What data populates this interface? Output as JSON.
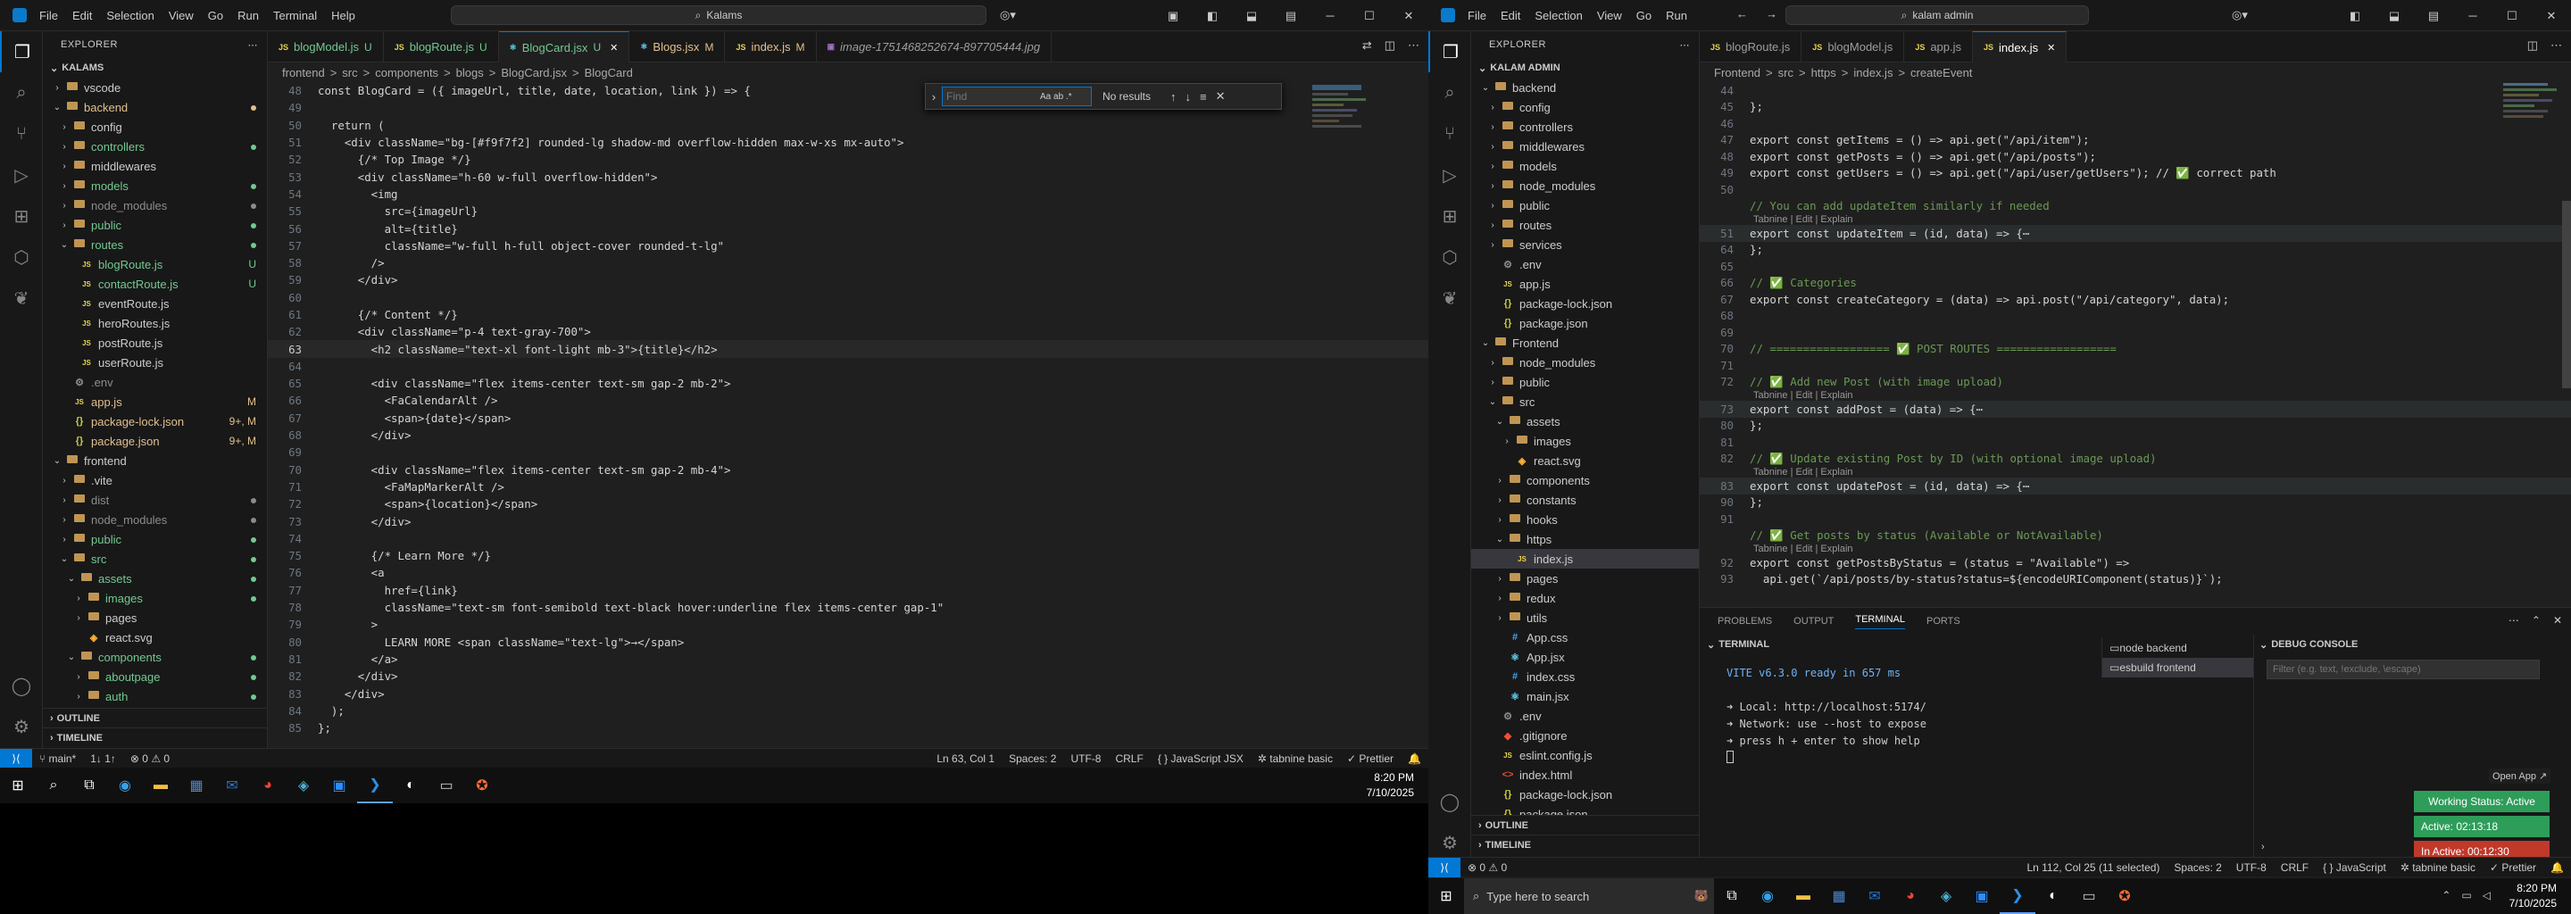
{
  "left": {
    "menu": [
      "File",
      "Edit",
      "Selection",
      "View",
      "Go",
      "Run",
      "Terminal",
      "Help"
    ],
    "search": "Kalams",
    "explorer_title": "EXPLORER",
    "root": "KALAMS",
    "tree": [
      {
        "d": 1,
        "t": "folder",
        "c": "closed",
        "name": "vscode"
      },
      {
        "d": 1,
        "t": "folder",
        "c": "open",
        "name": "backend",
        "color": "#e2c08d"
      },
      {
        "d": 2,
        "t": "folder",
        "c": "closed",
        "name": "config"
      },
      {
        "d": 2,
        "t": "folder",
        "c": "closed",
        "name": "controllers",
        "color": "#73c991"
      },
      {
        "d": 2,
        "t": "folder",
        "c": "closed",
        "name": "middlewares"
      },
      {
        "d": 2,
        "t": "folder",
        "c": "closed",
        "name": "models",
        "color": "#73c991"
      },
      {
        "d": 2,
        "t": "folder",
        "c": "closed",
        "name": "node_modules",
        "color": "#8c8c8c"
      },
      {
        "d": 2,
        "t": "folder",
        "c": "closed",
        "name": "public",
        "color": "#73c991"
      },
      {
        "d": 2,
        "t": "folder",
        "c": "open",
        "name": "routes",
        "color": "#73c991"
      },
      {
        "d": 3,
        "t": "js",
        "name": "blogRoute.js",
        "color": "#73c991",
        "badge": "U"
      },
      {
        "d": 3,
        "t": "js",
        "name": "contactRoute.js",
        "color": "#73c991",
        "badge": "U"
      },
      {
        "d": 3,
        "t": "js",
        "name": "eventRoute.js"
      },
      {
        "d": 3,
        "t": "js",
        "name": "heroRoutes.js"
      },
      {
        "d": 3,
        "t": "js",
        "name": "postRoute.js"
      },
      {
        "d": 3,
        "t": "js",
        "name": "userRoute.js"
      },
      {
        "d": 2,
        "t": "env",
        "name": ".env",
        "color": "#8c8c8c"
      },
      {
        "d": 2,
        "t": "js",
        "name": "app.js",
        "color": "#e2c08d",
        "badge": "M"
      },
      {
        "d": 2,
        "t": "json",
        "name": "package-lock.json",
        "color": "#e2c08d",
        "badge": "9+, M"
      },
      {
        "d": 2,
        "t": "json",
        "name": "package.json",
        "color": "#e2c08d",
        "badge": "9+, M"
      },
      {
        "d": 1,
        "t": "folder",
        "c": "open",
        "name": "frontend"
      },
      {
        "d": 2,
        "t": "folder",
        "c": "closed",
        "name": ".vite"
      },
      {
        "d": 2,
        "t": "folder",
        "c": "closed",
        "name": "dist",
        "color": "#8c8c8c"
      },
      {
        "d": 2,
        "t": "folder",
        "c": "closed",
        "name": "node_modules",
        "color": "#8c8c8c"
      },
      {
        "d": 2,
        "t": "folder",
        "c": "closed",
        "name": "public",
        "color": "#73c991"
      },
      {
        "d": 2,
        "t": "folder",
        "c": "open",
        "name": "src",
        "color": "#73c991"
      },
      {
        "d": 3,
        "t": "folder",
        "c": "open",
        "name": "assets",
        "color": "#73c991"
      },
      {
        "d": 4,
        "t": "folder",
        "c": "closed",
        "name": "images",
        "color": "#73c991"
      },
      {
        "d": 4,
        "t": "folder",
        "c": "closed",
        "name": "pages"
      },
      {
        "d": 4,
        "t": "svg",
        "name": "react.svg"
      },
      {
        "d": 3,
        "t": "folder",
        "c": "open",
        "name": "components",
        "color": "#73c991"
      },
      {
        "d": 4,
        "t": "folder",
        "c": "closed",
        "name": "aboutpage",
        "color": "#73c991"
      },
      {
        "d": 4,
        "t": "folder",
        "c": "closed",
        "name": "auth",
        "color": "#73c991"
      }
    ],
    "outline": "OUTLINE",
    "timeline": "TIMELINE",
    "tabs": [
      {
        "name": "blogModel.js",
        "mod": "U"
      },
      {
        "name": "blogRoute.js",
        "mod": "U"
      },
      {
        "name": "BlogCard.jsx",
        "mod": "U",
        "active": true
      },
      {
        "name": "Blogs.jsx",
        "mod": "M"
      },
      {
        "name": "index.js",
        "mod": "M"
      },
      {
        "name": "image-1751468252674-897705444.jpg",
        "mod": ""
      }
    ],
    "breadcrumb": [
      "frontend",
      ">",
      "src",
      ">",
      "components",
      ">",
      "blogs",
      ">",
      "BlogCard.jsx",
      ">",
      "BlogCard"
    ],
    "find": {
      "placeholder": "Find",
      "result": "No results",
      "opts": "Aa  ab  .*"
    },
    "code_start": 48,
    "code": [
      "const BlogCard = ({ imageUrl, title, date, location, link }) => {",
      "",
      "  return (",
      "    <div className=\"bg-[#f9f7f2] rounded-lg shadow-md overflow-hidden max-w-xs mx-auto\">",
      "      {/* Top Image */}",
      "      <div className=\"h-60 w-full overflow-hidden\">",
      "        <img",
      "          src={imageUrl}",
      "          alt={title}",
      "          className=\"w-full h-full object-cover rounded-t-lg\"",
      "        />",
      "      </div>",
      "",
      "      {/* Content */}",
      "      <div className=\"p-4 text-gray-700\">",
      "        <h2 className=\"text-xl font-light mb-3\">{title}</h2>",
      "",
      "        <div className=\"flex items-center text-sm gap-2 mb-2\">",
      "          <FaCalendarAlt />",
      "          <span>{date}</span>",
      "        </div>",
      "",
      "        <div className=\"flex items-center text-sm gap-2 mb-4\">",
      "          <FaMapMarkerAlt />",
      "          <span>{location}</span>",
      "        </div>",
      "",
      "        {/* Learn More */}",
      "        <a",
      "          href={link}",
      "          className=\"text-sm font-semibold text-black hover:underline flex items-center gap-1\"",
      "        >",
      "          LEARN MORE <span className=\"text-lg\">→</span>",
      "        </a>",
      "      </div>",
      "    </div>",
      "  );",
      "};"
    ],
    "status": {
      "branch": "main*",
      "sync": "1↓ 1↑",
      "errors": "⊗ 0 ⚠ 0",
      "pos": "Ln 63, Col 1",
      "spaces": "Spaces: 2",
      "enc": "UTF-8",
      "eol": "CRLF",
      "lang": "{ } JavaScript JSX",
      "tabnine": "tabnine basic",
      "prettier": "✓ Prettier"
    },
    "clock": {
      "time": "8:20 PM",
      "date": "7/10/2025"
    }
  },
  "right": {
    "menu": [
      "File",
      "Edit",
      "Selection",
      "View",
      "Go",
      "Run"
    ],
    "search": "kalam admin",
    "explorer_title": "EXPLORER",
    "root": "KALAM ADMIN",
    "tree": [
      {
        "d": 1,
        "t": "folder",
        "c": "open",
        "name": "backend"
      },
      {
        "d": 2,
        "t": "folder",
        "c": "closed",
        "name": "config"
      },
      {
        "d": 2,
        "t": "folder",
        "c": "closed",
        "name": "controllers"
      },
      {
        "d": 2,
        "t": "folder",
        "c": "closed",
        "name": "middlewares"
      },
      {
        "d": 2,
        "t": "folder",
        "c": "closed",
        "name": "models"
      },
      {
        "d": 2,
        "t": "folder",
        "c": "closed",
        "name": "node_modules"
      },
      {
        "d": 2,
        "t": "folder",
        "c": "closed",
        "name": "public"
      },
      {
        "d": 2,
        "t": "folder",
        "c": "closed",
        "name": "routes"
      },
      {
        "d": 2,
        "t": "folder",
        "c": "closed",
        "name": "services"
      },
      {
        "d": 2,
        "t": "env",
        "name": ".env"
      },
      {
        "d": 2,
        "t": "js",
        "name": "app.js"
      },
      {
        "d": 2,
        "t": "json",
        "name": "package-lock.json"
      },
      {
        "d": 2,
        "t": "json",
        "name": "package.json"
      },
      {
        "d": 1,
        "t": "folder",
        "c": "open",
        "name": "Frontend"
      },
      {
        "d": 2,
        "t": "folder",
        "c": "closed",
        "name": "node_modules"
      },
      {
        "d": 2,
        "t": "folder",
        "c": "closed",
        "name": "public"
      },
      {
        "d": 2,
        "t": "folder",
        "c": "open",
        "name": "src"
      },
      {
        "d": 3,
        "t": "folder",
        "c": "open",
        "name": "assets"
      },
      {
        "d": 4,
        "t": "folder",
        "c": "closed",
        "name": "images"
      },
      {
        "d": 4,
        "t": "svg",
        "name": "react.svg"
      },
      {
        "d": 3,
        "t": "folder",
        "c": "closed",
        "name": "components"
      },
      {
        "d": 3,
        "t": "folder",
        "c": "closed",
        "name": "constants"
      },
      {
        "d": 3,
        "t": "folder",
        "c": "closed",
        "name": "hooks"
      },
      {
        "d": 3,
        "t": "folder",
        "c": "open",
        "name": "https"
      },
      {
        "d": 4,
        "t": "js",
        "name": "index.js",
        "sel": true
      },
      {
        "d": 3,
        "t": "folder",
        "c": "closed",
        "name": "pages"
      },
      {
        "d": 3,
        "t": "folder",
        "c": "closed",
        "name": "redux"
      },
      {
        "d": 3,
        "t": "folder",
        "c": "closed",
        "name": "utils"
      },
      {
        "d": 3,
        "t": "css",
        "name": "App.css"
      },
      {
        "d": 3,
        "t": "jsx",
        "name": "App.jsx"
      },
      {
        "d": 3,
        "t": "css",
        "name": "index.css"
      },
      {
        "d": 3,
        "t": "jsx",
        "name": "main.jsx"
      },
      {
        "d": 2,
        "t": "env",
        "name": ".env"
      },
      {
        "d": 2,
        "t": "git",
        "name": ".gitignore"
      },
      {
        "d": 2,
        "t": "js",
        "name": "eslint.config.js"
      },
      {
        "d": 2,
        "t": "html",
        "name": "index.html"
      },
      {
        "d": 2,
        "t": "json",
        "name": "package-lock.json"
      },
      {
        "d": 2,
        "t": "json",
        "name": "package.json"
      }
    ],
    "outline": "OUTLINE",
    "timeline": "TIMELINE",
    "tabs": [
      {
        "name": "blogRoute.js"
      },
      {
        "name": "blogModel.js"
      },
      {
        "name": "app.js"
      },
      {
        "name": "index.js",
        "active": true
      }
    ],
    "breadcrumb": [
      "Frontend",
      ">",
      "src",
      ">",
      "https",
      ">",
      "index.js",
      ">",
      "createEvent"
    ],
    "lens": "Tabnine | Edit | Explain",
    "code": [
      {
        "n": "44",
        "s": ""
      },
      {
        "n": "45",
        "s": "};"
      },
      {
        "n": "46",
        "s": ""
      },
      {
        "n": "47",
        "s": "export const getItems = () => api.get(\"/api/item\");"
      },
      {
        "n": "48",
        "s": "export const getPosts = () => api.get(\"/api/posts\");"
      },
      {
        "n": "49",
        "s": "export const getUsers = () => api.get(\"/api/user/getUsers\"); // ✅ correct path"
      },
      {
        "n": "50",
        "s": ""
      },
      {
        "n": "",
        "s": "// You can add updateItem similarly if needed",
        "c": 1
      },
      {
        "n": "51",
        "s": "export const updateItem = (id, data) => {⋯",
        "lens": 1,
        "fold": 1
      },
      {
        "n": "64",
        "s": "};"
      },
      {
        "n": "65",
        "s": ""
      },
      {
        "n": "66",
        "s": "// ✅ Categories",
        "c": 1
      },
      {
        "n": "67",
        "s": "export const createCategory = (data) => api.post(\"/api/category\", data);"
      },
      {
        "n": "68",
        "s": ""
      },
      {
        "n": "69",
        "s": ""
      },
      {
        "n": "70",
        "s": "// ================== ✅ POST ROUTES ==================",
        "c": 1
      },
      {
        "n": "71",
        "s": ""
      },
      {
        "n": "72",
        "s": "// ✅ Add new Post (with image upload)",
        "c": 1
      },
      {
        "n": "73",
        "s": "export const addPost = (data) => {⋯",
        "lens": 1,
        "fold": 1
      },
      {
        "n": "80",
        "s": "};"
      },
      {
        "n": "81",
        "s": ""
      },
      {
        "n": "82",
        "s": "// ✅ Update existing Post by ID (with optional image upload)",
        "c": 1
      },
      {
        "n": "83",
        "s": "export const updatePost = (id, data) => {⋯",
        "lens": 1,
        "fold": 1
      },
      {
        "n": "90",
        "s": "};"
      },
      {
        "n": "91",
        "s": ""
      },
      {
        "n": "",
        "s": "// ✅ Get posts by status (Available or NotAvailable)",
        "c": 1
      },
      {
        "n": "92",
        "s": "export const getPostsByStatus = (status = \"Available\") =>",
        "lens": 1
      },
      {
        "n": "93",
        "s": "  api.get(`/api/posts/by-status?status=${encodeURIComponent(status)}`);"
      }
    ],
    "panel_tabs": [
      "PROBLEMS",
      "OUTPUT",
      "TERMINAL",
      "PORTS"
    ],
    "terminal_label": "TERMINAL",
    "terminal": [
      {
        "t": "VITE v6.3.0  ready in 657 ms",
        "cls": "vite"
      },
      {
        "t": ""
      },
      {
        "t": "➜  Local:   http://localhost:5174/",
        "cls": "local"
      },
      {
        "t": "➜  Network: use --host to expose"
      },
      {
        "t": "➜  press h + enter to show help"
      }
    ],
    "term_list": [
      "node  backend",
      "esbuild  frontend"
    ],
    "debug_console": "DEBUG CONSOLE",
    "debug_filter": "Filter (e.g. text, !exclude, \\escape)",
    "work": {
      "open": "Open App ↗",
      "status": "Working Status: Active",
      "active": "Active: 02:13:18",
      "inactive": "In Active: 00:12:30"
    },
    "status": {
      "errors": "⊗ 0 ⚠ 0",
      "pos": "Ln 112, Col 25 (11 selected)",
      "spaces": "Spaces: 2",
      "enc": "UTF-8",
      "eol": "CRLF",
      "lang": "{ } JavaScript",
      "tabnine": "tabnine basic",
      "prettier": "✓ Prettier"
    },
    "taskbar_search": "Type here to search",
    "clock": {
      "time": "8:20 PM",
      "date": "7/10/2025"
    }
  }
}
